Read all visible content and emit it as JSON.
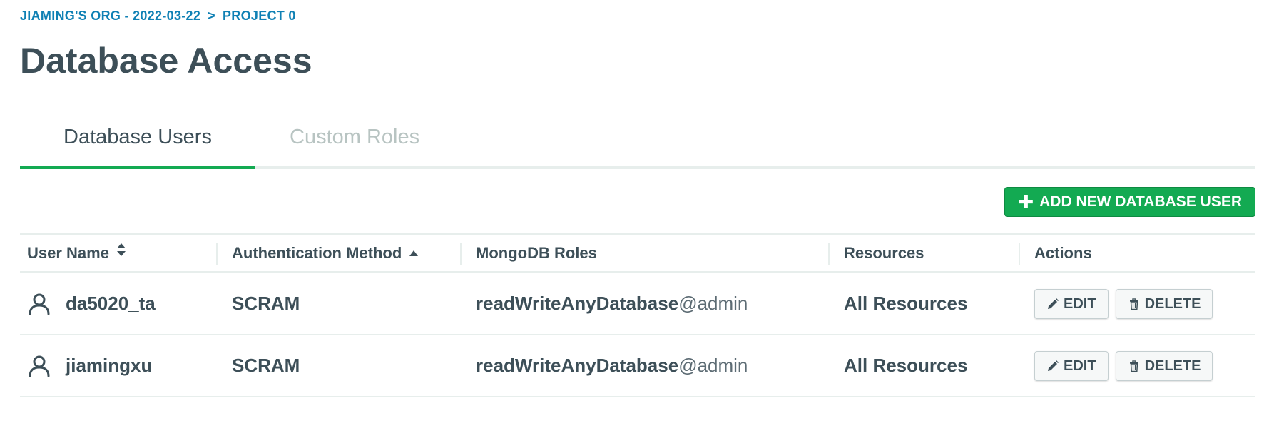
{
  "breadcrumb": {
    "org": "JIAMING'S ORG - 2022-03-22",
    "separator": ">",
    "project": "PROJECT 0"
  },
  "page_title": "Database Access",
  "tabs": [
    {
      "label": "Database Users",
      "active": true
    },
    {
      "label": "Custom Roles",
      "active": false
    }
  ],
  "toolbar": {
    "add_button_icon": "plus-icon",
    "add_button_label": "ADD NEW DATABASE USER"
  },
  "table": {
    "columns": [
      {
        "label": "User Name",
        "sort": "sortable"
      },
      {
        "label": "Authentication Method",
        "sort": "ascending"
      },
      {
        "label": "MongoDB Roles",
        "sort": "none"
      },
      {
        "label": "Resources",
        "sort": "none"
      },
      {
        "label": "Actions",
        "sort": "none"
      }
    ],
    "rows": [
      {
        "icon": "person-icon",
        "user_name": "da5020_ta",
        "auth_method": "SCRAM",
        "role_name": "readWriteAnyDatabase",
        "role_db": "@admin",
        "resources": "All Resources",
        "edit_label": "EDIT",
        "delete_label": "DELETE"
      },
      {
        "icon": "person-icon",
        "user_name": "jiamingxu",
        "auth_method": "SCRAM",
        "role_name": "readWriteAnyDatabase",
        "role_db": "@admin",
        "resources": "All Resources",
        "edit_label": "EDIT",
        "delete_label": "DELETE"
      }
    ]
  },
  "colors": {
    "accent_green": "#13aa52",
    "link_blue": "#0f80b4",
    "text": "#3d4f58",
    "inactive_tab": "#b8c4c2"
  }
}
